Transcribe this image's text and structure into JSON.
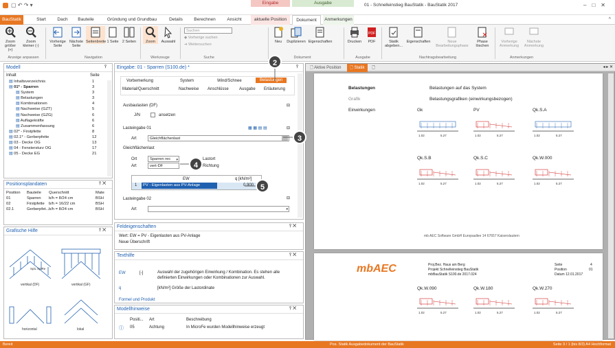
{
  "window": {
    "title": "01 - Schnelleinstieg BauStatik - BauStatik 2017",
    "controls": [
      "–",
      "□",
      "✕"
    ]
  },
  "context_bands": {
    "eingabe": "Eingabe",
    "ausgabe": "Ausgabe"
  },
  "tabs": [
    "BauStatik",
    "Start",
    "Dach",
    "Bauteile",
    "Gründung und Grundbau",
    "Details",
    "Berechnen",
    "Ansicht",
    "aktuelle Position",
    "Dokument",
    "Anmerkungen"
  ],
  "ribbon": {
    "zoom_groesser": "Zoom größer (+)",
    "zoom_kleiner": "Zoom kleiner (-)",
    "vorherige_seite": "Vorherige Seite",
    "naechste_seite": "Nächste Seite",
    "seitenbreite": "Seitenbreite",
    "eine_seite": "1 Seite",
    "zwei_seiten": "2 Seiten",
    "zoom": "Zoom",
    "auswahl": "Auswahl",
    "suchen": "Suchen",
    "vorherige_suchen": "Vorherige suchen",
    "weitersuchen": "Weitersuchen",
    "neu": "Neu",
    "duplizieren": "Duplizieren",
    "eigenschaften": "Eigenschaften",
    "drucken": "Drucken",
    "pdf": "PDF",
    "statik_abgeben": "Statik abgeben...",
    "eigenschaften2": "Eigenschaften",
    "neue_phase": "Neue Bearbeitungsphase",
    "phase_loeschen": "Phase löschen",
    "vorherige_anm": "Vorherige Anmerkung",
    "naechste_anm": "Nächste Anmerkung",
    "groups": [
      "Anzeige anpassen",
      "Navigation",
      "Werkzeuge",
      "Suche",
      "Dokument",
      "Ausgabe",
      "Nachtragsbearbeitung",
      "Anmerkungen"
    ]
  },
  "modell": {
    "title": "Modell",
    "col_inhalt": "Inhalt",
    "col_seite": "Seite",
    "items": [
      {
        "label": "Inhaltsverzeichnis",
        "seite": "1"
      },
      {
        "label": "01* - Sparren",
        "seite": "3"
      },
      {
        "label": "System",
        "seite": "3"
      },
      {
        "label": "Belastungen",
        "seite": "3"
      },
      {
        "label": "Kombinationen",
        "seite": "4"
      },
      {
        "label": "Nachweise (GZT)",
        "seite": "5"
      },
      {
        "label": "Nachweise (GZG)",
        "seite": "6"
      },
      {
        "label": "Auflagekräfte",
        "seite": "6"
      },
      {
        "label": "Zusammenfassung",
        "seite": "6"
      },
      {
        "label": "02* - Firstpfette",
        "seite": "8"
      },
      {
        "label": "02.1* - Gerberpfette",
        "seite": "12"
      },
      {
        "label": "03 - Decke OG",
        "seite": "13"
      },
      {
        "label": "04 - Fenstersturz OG",
        "seite": "17"
      },
      {
        "label": "05 - Decke EG",
        "seite": "21"
      }
    ]
  },
  "positionsplan": {
    "title": "Positionsplandaten",
    "headers": [
      "Position",
      "Bauteile",
      "Querschnitt",
      "Mate"
    ],
    "rows": [
      [
        "01",
        "Sparren",
        "b/h = 8/24 cm",
        "BSH"
      ],
      [
        "02",
        "Firstpfette",
        "b/h = 16/22 cm",
        "BSH"
      ],
      [
        "02.1",
        "Gerberpfet...",
        "b/h = 8/24 cm",
        "BSH"
      ]
    ]
  },
  "grafische_hilfe": {
    "title": "Grafische Hilfe",
    "captions": [
      "vertikal (DF)",
      "vertikal (GF)",
      "horizontal",
      "lokal"
    ],
    "labels": [
      "SpiL",
      "SpiRe"
    ]
  },
  "eingabe": {
    "title": "Eingabe: 01 - Sparren (S100.de) *",
    "tabs_row1": [
      "Vorbemerkung",
      "System",
      "Wind/Schnee",
      "Belastungen"
    ],
    "tabs_row2": [
      "Material/Querschnitt",
      "Nachweise",
      "Anschlüsse",
      "Ausgabe",
      "Erläuterung"
    ],
    "ausbaulasten": "Ausbaulasten (DF)",
    "jn": "J/N",
    "ansetzen": "ansetzen",
    "lasteingabe01": "Lasteingabe 01",
    "art": "Art",
    "art_value": "Gleichflächenlast",
    "gleichflaechenlast": "Gleichflächenlast",
    "ort": "Ort",
    "ort_value": "Sparren rec",
    "lastort": "Lastort",
    "art2_value": "vert-DF",
    "richtung": "Richtung",
    "table_h1": "EW",
    "table_h2": "q [kN/m²]",
    "row_num": "1",
    "row_ew": "PV - Eigenlasten aus PV-Anlage",
    "row_q": "0.900",
    "lasteingabe02": "Lasteingabe 02",
    "art3": "Art"
  },
  "feldeigenschaften": {
    "title": "Feldeigenschaften",
    "line1": "Wert: EW = PV - Eigenlasten aus PV-Anlage",
    "line2": "Neue Überschrift"
  },
  "texthilfe": {
    "title": "Texthilfe",
    "ew": "EW",
    "bracket": "[-]",
    "ew_text": "Auswahl der zugehörigen Einwirkung / Kombination. Es stehen alle definierten Einwirkungen oder Kombinationen zur Auswahl.",
    "q": "q",
    "q_text": "[kN/m²] Größe der Lastordinate",
    "footer": "Formel und Produkt"
  },
  "modellhinweise": {
    "title": "Modellhinweise",
    "headers": [
      "Positi...",
      "Art",
      "Beschreibung"
    ],
    "row": [
      "05",
      "Achtung",
      "In MicroFe wurden Modellhinweise erzeugt"
    ]
  },
  "preview": {
    "tabs": [
      "Aktive Position",
      "Statik"
    ],
    "belastungen": "Belastungen",
    "belastungen_text": "Belastungen auf das System",
    "grafik": "Grafik",
    "grafik_text": "Belastungsgrafiken (einwirkungsbezogen)",
    "einwirkungen": "Einwirkungen",
    "charts1": [
      "Gk",
      "PV",
      "Qk.S.A"
    ],
    "charts2": [
      "Qk.S.B",
      "Qk.S.C",
      "Qk.W.000"
    ],
    "charts3": [
      "Qk.W.090",
      "Qk.W.180",
      "Qk.W.270"
    ],
    "footer": "mb AEC Software GmbH   Europaallee 14   67657 Kaiserslautern",
    "logo": "mbAEC",
    "page2_proj": "Proj.Bez.  Haus am Berg",
    "page2_projekt": "Projekt  Schnelleinstieg BauStatik",
    "page2_file": "mbBauStatik S100.de  2017.024",
    "page2_seite": "Seite",
    "page2_seite_val": "4",
    "page2_position": "Position",
    "page2_position_val": "01",
    "page2_datum": "Datum 12.01.2017",
    "dims": [
      "1.02",
      "5.27"
    ]
  },
  "callouts": [
    "2",
    "3",
    "4",
    "5"
  ],
  "statusbar": {
    "left": "Bereit",
    "center": "Pos. Statik  Ausgabedokument der BauStatik",
    "right": "Seite 3 / 1 (bis 8/3)   A4  Hochformat"
  },
  "colors": {
    "accent": "#e87722",
    "blue": "#2060b0",
    "eingabe_band": "#f4c7c3",
    "ausgabe_band": "#d9ead3"
  }
}
